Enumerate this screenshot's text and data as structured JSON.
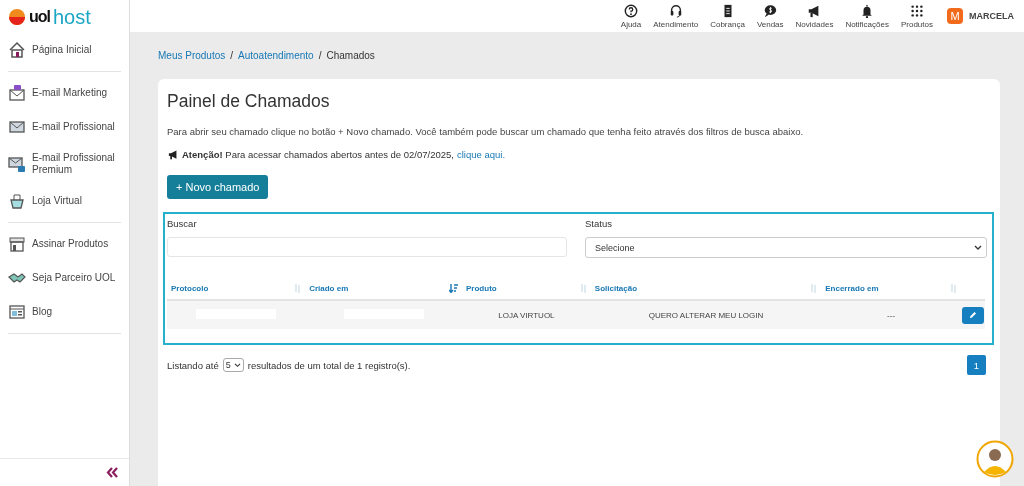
{
  "sidebar": {
    "logo": {
      "brand": "uol",
      "product": "host"
    },
    "groups": [
      [
        {
          "label": "Página Inicial"
        }
      ],
      [
        {
          "label": "E-mail Marketing"
        },
        {
          "label": "E-mail Profissional"
        },
        {
          "label": "E-mail Profissional Premium"
        },
        {
          "label": "Loja Virtual"
        }
      ],
      [
        {
          "label": "Assinar Produtos"
        },
        {
          "label": "Seja Parceiro UOL"
        },
        {
          "label": "Blog"
        }
      ]
    ]
  },
  "topbar": {
    "items": [
      {
        "label": "Ajuda"
      },
      {
        "label": "Atendimento"
      },
      {
        "label": "Cobrança"
      },
      {
        "label": "Vendas"
      },
      {
        "label": "Novidades"
      },
      {
        "label": "Notificações"
      },
      {
        "label": "Produtos"
      }
    ],
    "user": {
      "initial": "M",
      "name": "MARCELA"
    }
  },
  "breadcrumb": [
    {
      "label": "Meus Produtos",
      "link": true
    },
    {
      "separator": "/"
    },
    {
      "label": "Autoatendimento",
      "link": true
    },
    {
      "separator": "/"
    },
    {
      "label": "Chamados",
      "link": false
    }
  ],
  "panel": {
    "title": "Painel de Chamados",
    "description": "Para abrir seu chamado clique no botão + Novo chamado. Você também pode buscar um chamado que tenha feito através dos filtros de busca abaixo.",
    "notice": "**Atenção!** Para acessar chamados abertos antes de 02/07/2025,",
    "notice_link": "clique aqui.",
    "new_button": "+ Novo chamado",
    "search": {
      "label": "Buscar"
    },
    "status": {
      "label": "Status",
      "value": "Selecione"
    },
    "table": {
      "columns": [
        {
          "label": "Protocolo",
          "sorted": false
        },
        {
          "label": "Criado em",
          "sorted": true
        },
        {
          "label": "Produto",
          "sorted": false
        },
        {
          "label": "Solicitação",
          "sorted": false
        },
        {
          "label": "Encerrado em",
          "sorted": false
        }
      ],
      "rows": [
        {
          "cells": [
            "",
            "",
            "LOJA VIRTUOL",
            "QUERO ALTERAR MEU LOGIN",
            "---"
          ]
        }
      ]
    },
    "footer": {
      "prefix": "Listando até",
      "page_size": "5",
      "suffix": "resultados de um total de 1 registro(s)."
    },
    "pages": [
      {
        "label": "1",
        "selected": true
      }
    ]
  }
}
